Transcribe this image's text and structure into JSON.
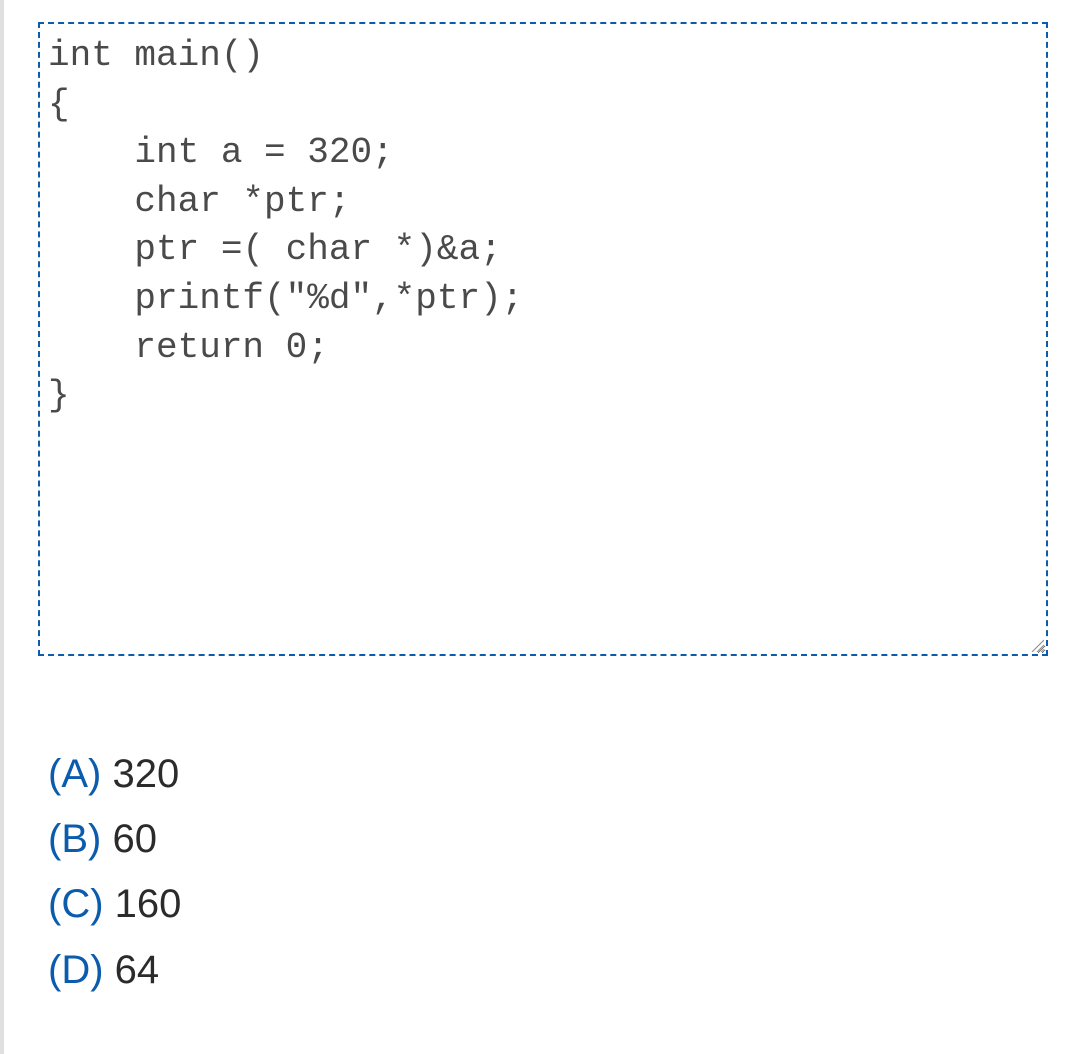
{
  "code": {
    "line1": "int main()",
    "line2": "{",
    "line3": "    int a = 320;",
    "line4": "    char *ptr;",
    "line5": "    ptr =( char *)&a;",
    "line6": "    printf(\"%d\",*ptr);",
    "line7": "    return 0;",
    "line8": "}"
  },
  "answers": [
    {
      "label": "(A)",
      "text": "320"
    },
    {
      "label": "(B)",
      "text": "60"
    },
    {
      "label": "(C)",
      "text": "160"
    },
    {
      "label": "(D)",
      "text": "64"
    }
  ]
}
